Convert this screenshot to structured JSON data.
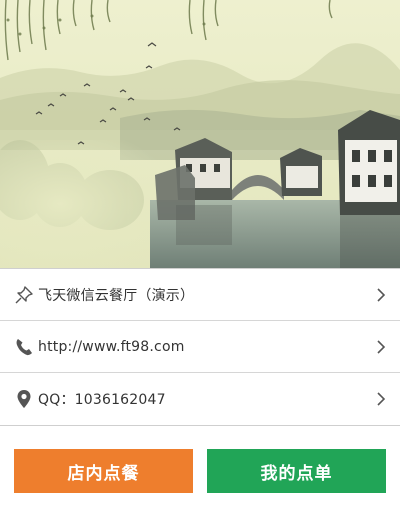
{
  "info": {
    "name": "飞天微信云餐厅（演示）",
    "website": "http://www.ft98.com",
    "qq": "QQ：1036162047"
  },
  "buttons": {
    "dine_in": "店内点餐",
    "my_order": "我的点单"
  },
  "icons": {
    "name_row": "pin-icon",
    "website_row": "phone-icon",
    "qq_row": "location-pin-icon",
    "chevron": "chevron-right-icon"
  },
  "colors": {
    "dine_in_button": "#ee7e2d",
    "my_order_button": "#21a557",
    "banner_sky": "#e9ebc4"
  }
}
